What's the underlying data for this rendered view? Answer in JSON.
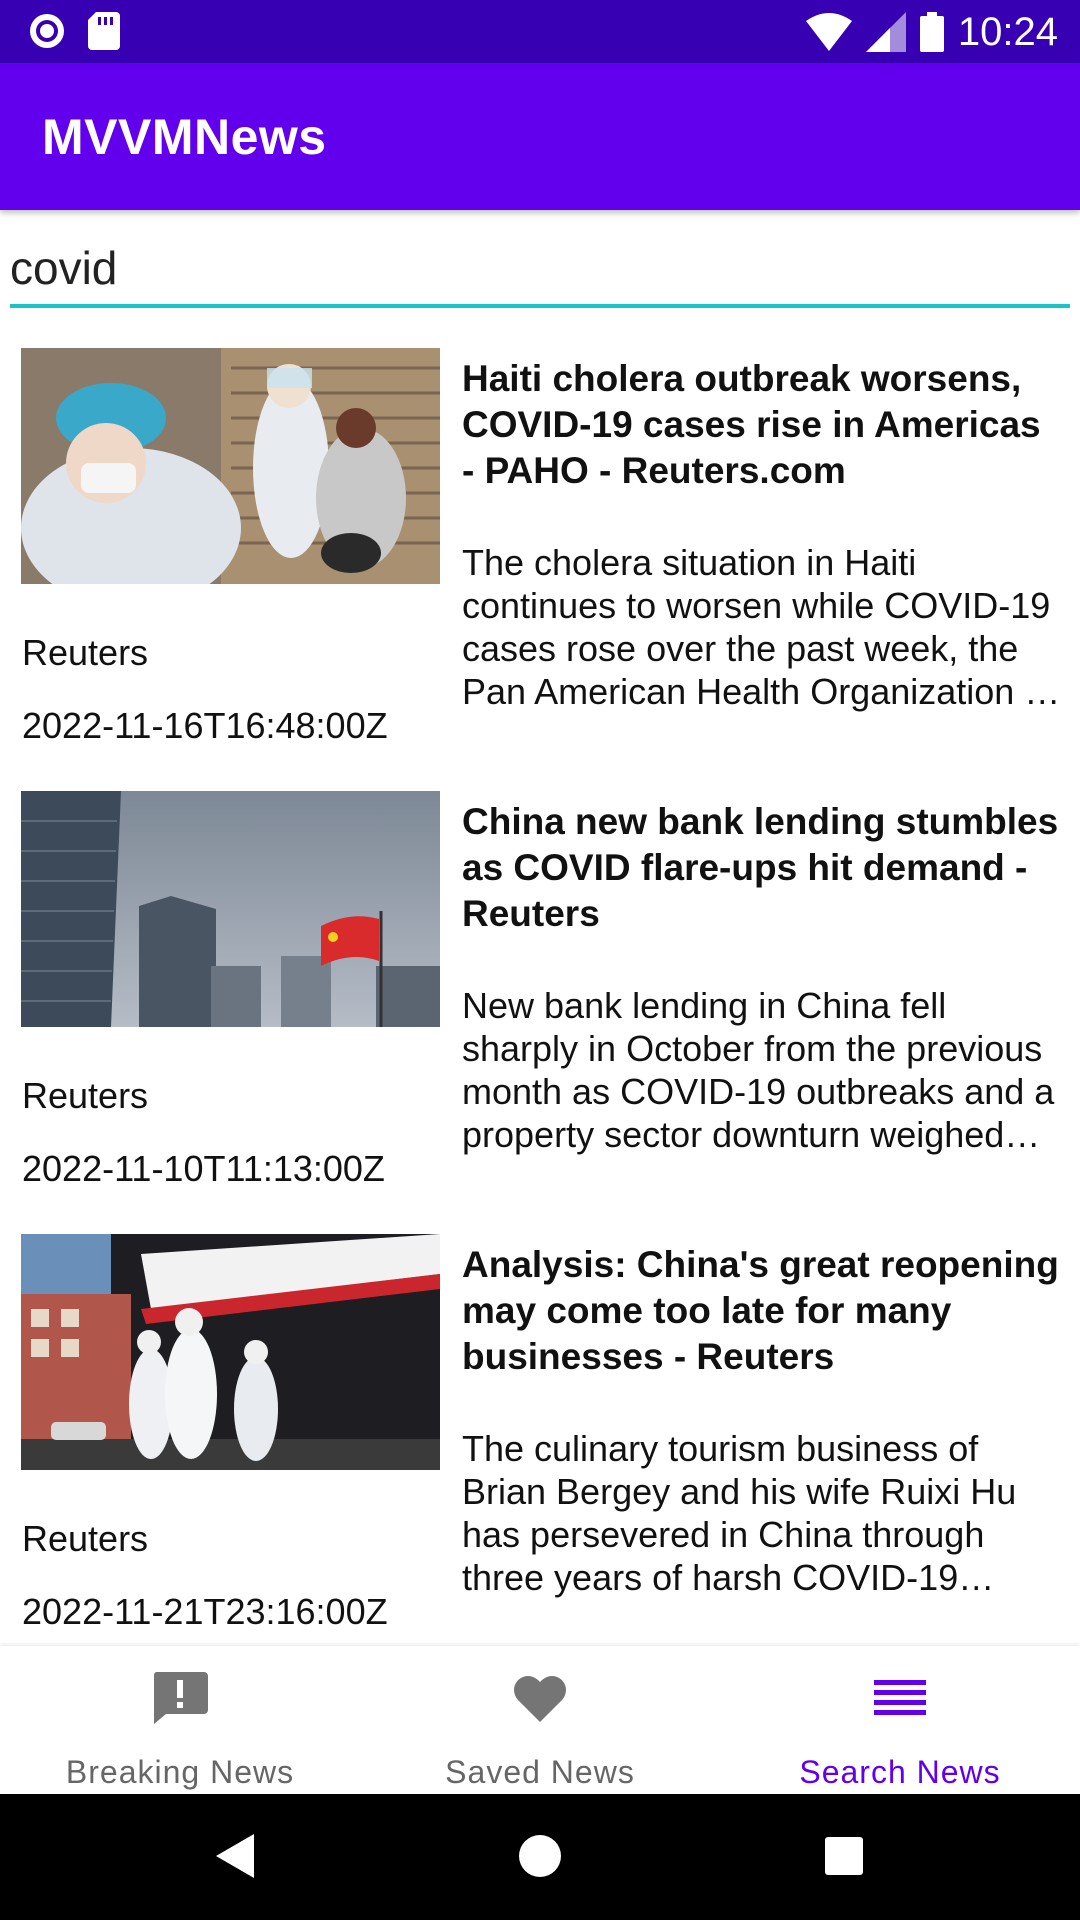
{
  "status_bar": {
    "time": "10:24",
    "icons": [
      "notification-dot-icon",
      "sd-card-icon",
      "wifi-icon",
      "cell-signal-icon",
      "battery-icon"
    ]
  },
  "app_bar": {
    "title": "MVVMNews"
  },
  "search": {
    "value": "covid",
    "accent_color": "#19C3C6"
  },
  "articles": [
    {
      "image_icon": "covid-testing-photo",
      "source": "Reuters",
      "published": "2022-11-16T16:48:00Z",
      "title": "Haiti cholera outbreak worsens, COVID-19 cases rise in Americas - PAHO - Reuters.com",
      "description": "The cholera situation in Haiti continues to worsen while COVID-19 cases rose over the past week, the Pan American Health Organization …"
    },
    {
      "image_icon": "beijing-skyline-photo",
      "source": "Reuters",
      "published": "2022-11-10T11:13:00Z",
      "title": "China new bank lending stumbles as COVID flare-ups hit demand - Reuters",
      "description": "New bank lending in China fell sharply in October from the previous month as COVID-19 outbreaks and a property sector downturn weighed…"
    },
    {
      "image_icon": "hazmat-workers-photo",
      "source": "Reuters",
      "published": "2022-11-21T23:16:00Z",
      "title": "Analysis: China's great reopening may come too late for many businesses - Reuters",
      "description": "The culinary tourism business of Brian Bergey and his wife Ruixi Hu has persevered in China through three years of harsh COVID-19 rest…"
    }
  ],
  "bottom_nav": {
    "items": [
      {
        "label": "Breaking News",
        "icon": "alert-icon",
        "active": false
      },
      {
        "label": "Saved News",
        "icon": "heart-icon",
        "active": false
      },
      {
        "label": "Search News",
        "icon": "list-icon",
        "active": true
      }
    ]
  },
  "colors": {
    "status_bar": "#3700B3",
    "primary": "#6200EE",
    "active_nav": "#6200EE",
    "inactive_nav": "#666666"
  }
}
